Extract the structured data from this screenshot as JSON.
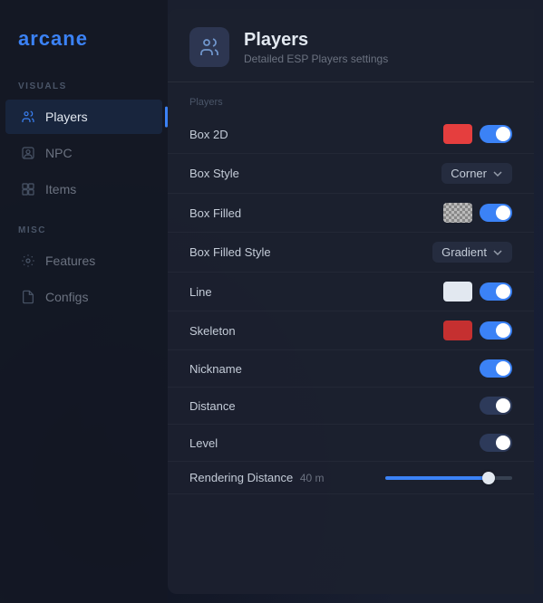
{
  "logo": "arcane",
  "sidebar": {
    "sections": [
      {
        "label": "VISUALS",
        "items": [
          {
            "id": "players",
            "label": "Players",
            "icon": "players-icon",
            "active": true
          },
          {
            "id": "npc",
            "label": "NPC",
            "icon": "npc-icon",
            "active": false
          },
          {
            "id": "items",
            "label": "Items",
            "icon": "items-icon",
            "active": false
          }
        ]
      },
      {
        "label": "MISC",
        "items": [
          {
            "id": "features",
            "label": "Features",
            "icon": "features-icon",
            "active": false
          },
          {
            "id": "configs",
            "label": "Configs",
            "icon": "configs-icon",
            "active": false
          }
        ]
      }
    ]
  },
  "panel": {
    "title": "Players",
    "subtitle": "Detailed ESP Players settings",
    "section_label": "Players",
    "rows": [
      {
        "id": "box2d",
        "label": "Box 2D",
        "color": "#e53e3e",
        "toggle": "on"
      },
      {
        "id": "box-style",
        "label": "Box Style",
        "dropdown": "Corner"
      },
      {
        "id": "box-filled",
        "label": "Box Filled",
        "checker": true,
        "toggle": "on"
      },
      {
        "id": "box-filled-style",
        "label": "Box Filled Style",
        "dropdown": "Gradient"
      },
      {
        "id": "line",
        "label": "Line",
        "color": "#e2e8f0",
        "toggle": "on"
      },
      {
        "id": "skeleton",
        "label": "Skeleton",
        "color": "#c53030",
        "toggle": "on"
      },
      {
        "id": "nickname",
        "label": "Nickname",
        "toggle": "on"
      },
      {
        "id": "distance",
        "label": "Distance",
        "toggle": "on"
      },
      {
        "id": "level",
        "label": "Level",
        "toggle": "on"
      },
      {
        "id": "rendering-distance",
        "label": "Rendering Distance",
        "slider_label": "40 m",
        "slider_value": 85
      }
    ]
  }
}
